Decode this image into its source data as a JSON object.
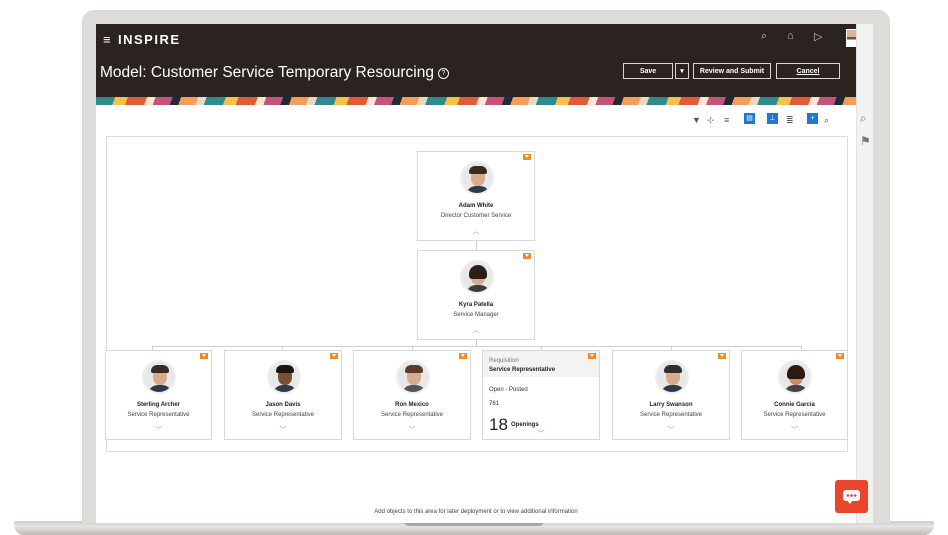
{
  "app": {
    "brand": "INSPIRE",
    "page_title": "Model: Customer Service Temporary Resourcing",
    "help_icon": "help-circle-icon",
    "header_icons": [
      "search-icon",
      "home-icon",
      "play-icon"
    ]
  },
  "actions": {
    "save_label": "Save",
    "save_menu_icon": "▾",
    "review_label": "Review and Submit",
    "cancel_label": "Cancel"
  },
  "toolbar": {
    "icons": [
      "filter-icon",
      "hierarchy-icon",
      "sliders-icon",
      "card-view-icon",
      "org-chart-icon",
      "list-icon",
      "zoom-in-icon",
      "zoom-out-icon"
    ]
  },
  "right_sidebar": {
    "icons": [
      "search-icon",
      "flag-icon"
    ]
  },
  "org": {
    "root": {
      "name": "Adam White",
      "title": "Director Customer Service"
    },
    "manager": {
      "name": "Kyra Patella",
      "title": "Service Manager"
    },
    "reports": [
      {
        "name": "Sterling Archer",
        "title": "Service Representative"
      },
      {
        "name": "Jason Davis",
        "title": "Service Representative"
      },
      {
        "name": "Ron Mexico",
        "title": "Service Representative"
      },
      {
        "name": "Larry Swanson",
        "title": "Service Representative"
      },
      {
        "name": "Connie Garcia",
        "title": "Service Representative"
      }
    ],
    "requisition": {
      "label": "Requisition",
      "title": "Service Representative",
      "status": "Open - Posted",
      "id": "761",
      "openings_count": "18",
      "openings_label": "Openings"
    }
  },
  "footer_note": "Add objects to this area for later deployment or to view additional information",
  "colors": {
    "header_bg": "#2a2320",
    "accent_orange": "#f08a24",
    "toolbar_blue": "#1f78d1",
    "chat_red": "#e8452c"
  }
}
